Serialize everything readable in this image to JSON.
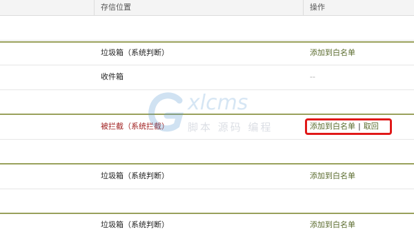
{
  "header": {
    "col_location": "存信位置",
    "col_action": "操作"
  },
  "rows": [
    {
      "location": "垃圾箱（系统判断）",
      "action": "添加到白名单"
    },
    {
      "location": "收件箱",
      "action": "--"
    },
    {
      "location": "被拦截（系统拦截）",
      "action": "添加到白名单",
      "action2": "取回"
    },
    {
      "location": "垃圾箱（系统判断）",
      "action": "添加到白名单"
    },
    {
      "location": "垃圾箱（系统判断）",
      "action": "添加到白名单"
    }
  ],
  "watermark": {
    "text": "xlcms",
    "sub": "脚本 源码 编程"
  },
  "colors": {
    "accent_green": "#98a05a",
    "link_green": "#5a6b2d",
    "blocked_red": "#a02020",
    "highlight_red": "#e01818"
  }
}
